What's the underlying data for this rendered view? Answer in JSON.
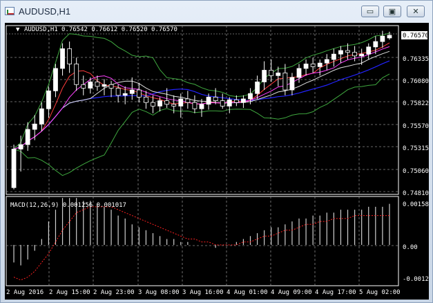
{
  "window": {
    "title": "AUDUSD,H1",
    "buttons": {
      "minimize": "▭",
      "maximize": "▣",
      "close": "✕"
    }
  },
  "colors": {
    "background": "#000000",
    "grid": "#8a8a8a",
    "bull_candle": "#ffffff",
    "bear_candle": "#000000",
    "ma_blue": "#2323ff",
    "ma_white": "#e0e0e0",
    "ma_red": "#ff3c3c",
    "ma_magenta": "#ff40ff",
    "bollinger": "#3fa83f",
    "macd_histogram": "#d0d0d0",
    "macd_signal": "#ff2020",
    "price_marker": "#ffffff"
  },
  "price_panel": {
    "header": "AUDUSD,H1",
    "ohlc": "0.76542 0.76612 0.76520 0.76570",
    "current_price": "0.76570",
    "price_labels": [
      "0.76335",
      "0.76080",
      "0.75822",
      "0.75570",
      "0.75315",
      "0.75060",
      "0.74810"
    ]
  },
  "macd_panel": {
    "label": "MACD(12,26,9) 0.001256 0.001017",
    "labels": [
      "0.001581",
      "0.00",
      "-0.001204"
    ]
  },
  "time_axis": [
    "2 Aug 2016",
    "2 Aug 15:00",
    "2 Aug 23:00",
    "3 Aug 08:00",
    "3 Aug 16:00",
    "4 Aug 01:00",
    "4 Aug 09:00",
    "4 Aug 17:00",
    "5 Aug 02:00"
  ],
  "chart_data": {
    "type": "candlestick",
    "symbol": "AUDUSD",
    "timeframe": "H1",
    "ohlc": [
      [
        0.7487,
        0.7535,
        0.7485,
        0.753
      ],
      [
        0.753,
        0.7545,
        0.7505,
        0.7535
      ],
      [
        0.7535,
        0.756,
        0.7528,
        0.7552
      ],
      [
        0.7552,
        0.7568,
        0.754,
        0.7558
      ],
      [
        0.7558,
        0.7582,
        0.755,
        0.7575
      ],
      [
        0.7575,
        0.76,
        0.7565,
        0.7595
      ],
      [
        0.7595,
        0.7625,
        0.7588,
        0.762
      ],
      [
        0.762,
        0.7648,
        0.7612,
        0.7642
      ],
      [
        0.7642,
        0.765,
        0.7615,
        0.7625
      ],
      [
        0.7625,
        0.7632,
        0.7595,
        0.7602
      ],
      [
        0.7602,
        0.7612,
        0.759,
        0.7598
      ],
      [
        0.7598,
        0.761,
        0.7592,
        0.7605
      ],
      [
        0.7605,
        0.7612,
        0.7595,
        0.76
      ],
      [
        0.76,
        0.7608,
        0.759,
        0.7602
      ],
      [
        0.7602,
        0.7606,
        0.7588,
        0.7598
      ],
      [
        0.7598,
        0.7602,
        0.7582,
        0.759
      ],
      [
        0.759,
        0.76,
        0.758,
        0.7592
      ],
      [
        0.7592,
        0.761,
        0.7585,
        0.7596
      ],
      [
        0.7596,
        0.7604,
        0.7582,
        0.7588
      ],
      [
        0.7588,
        0.7595,
        0.7575,
        0.7582
      ],
      [
        0.7582,
        0.759,
        0.757,
        0.7578
      ],
      [
        0.7578,
        0.7588,
        0.7572,
        0.7584
      ],
      [
        0.7584,
        0.7598,
        0.7576,
        0.758
      ],
      [
        0.758,
        0.759,
        0.757,
        0.7578
      ],
      [
        0.7578,
        0.7592,
        0.7565,
        0.7586
      ],
      [
        0.7586,
        0.7595,
        0.7575,
        0.7582
      ],
      [
        0.7582,
        0.759,
        0.757,
        0.7575
      ],
      [
        0.7575,
        0.7586,
        0.7566,
        0.758
      ],
      [
        0.758,
        0.7592,
        0.7574,
        0.7588
      ],
      [
        0.7588,
        0.7598,
        0.758,
        0.7584
      ],
      [
        0.7584,
        0.7592,
        0.7575,
        0.7578
      ],
      [
        0.7578,
        0.7588,
        0.757,
        0.7585
      ],
      [
        0.7585,
        0.759,
        0.7578,
        0.7582
      ],
      [
        0.7582,
        0.759,
        0.7576,
        0.7586
      ],
      [
        0.7586,
        0.7598,
        0.758,
        0.7592
      ],
      [
        0.7592,
        0.7612,
        0.7586,
        0.7605
      ],
      [
        0.7605,
        0.7628,
        0.7596,
        0.7618
      ],
      [
        0.7618,
        0.763,
        0.7605,
        0.7612
      ],
      [
        0.7612,
        0.7622,
        0.76,
        0.7615
      ],
      [
        0.7615,
        0.7625,
        0.759,
        0.7596
      ],
      [
        0.7596,
        0.7615,
        0.759,
        0.761
      ],
      [
        0.761,
        0.7625,
        0.7604,
        0.762
      ],
      [
        0.762,
        0.763,
        0.7612,
        0.7625
      ],
      [
        0.7625,
        0.7632,
        0.7615,
        0.7622
      ],
      [
        0.7622,
        0.763,
        0.7612,
        0.7626
      ],
      [
        0.7626,
        0.7636,
        0.7618,
        0.763
      ],
      [
        0.763,
        0.7642,
        0.7622,
        0.7636
      ],
      [
        0.7636,
        0.7645,
        0.7626,
        0.764
      ],
      [
        0.764,
        0.7648,
        0.763,
        0.7638
      ],
      [
        0.7638,
        0.7645,
        0.7628,
        0.7634
      ],
      [
        0.7634,
        0.7642,
        0.7624,
        0.7636
      ],
      [
        0.7636,
        0.7648,
        0.763,
        0.7644
      ],
      [
        0.7644,
        0.7656,
        0.7636,
        0.765
      ],
      [
        0.765,
        0.7662,
        0.7643,
        0.7656
      ],
      [
        0.7654,
        0.7661,
        0.7652,
        0.7657
      ]
    ],
    "y_range": [
      0.7481,
      0.7657
    ],
    "macd_histogram": [
      -0.0006,
      -0.0007,
      -0.0005,
      -0.0002,
      0.0002,
      0.0008,
      0.0012,
      0.0016,
      0.0016,
      0.0016,
      0.0015,
      0.0015,
      0.0014,
      0.0013,
      0.0012,
      0.001,
      0.0009,
      0.0007,
      0.0006,
      0.0005,
      0.0004,
      0.0003,
      0.0002,
      0.0002,
      0.0001,
      0.0001,
      0.0,
      0.0,
      0.0,
      -0.0001,
      0.0,
      0.0,
      0.0001,
      0.0002,
      0.0003,
      0.0004,
      0.0005,
      0.0006,
      0.0006,
      0.0007,
      0.0008,
      0.0009,
      0.0009,
      0.001,
      0.001,
      0.0011,
      0.0011,
      0.0012,
      0.0012,
      0.0012,
      0.0012,
      0.0013,
      0.0013,
      0.0013,
      0.0014
    ],
    "macd_signal": [
      -0.0011,
      -0.0012,
      -0.0011,
      -0.0009,
      -0.0006,
      -0.0003,
      0.0001,
      0.0005,
      0.0008,
      0.0011,
      0.0012,
      0.0013,
      0.0013,
      0.0013,
      0.0013,
      0.0012,
      0.0011,
      0.001,
      0.0009,
      0.0008,
      0.0007,
      0.0006,
      0.0005,
      0.0004,
      0.0003,
      0.0002,
      0.0002,
      0.0001,
      0.0001,
      0.0,
      0.0,
      0.0,
      0.0,
      0.0001,
      0.0001,
      0.0002,
      0.0003,
      0.0003,
      0.0004,
      0.0005,
      0.0005,
      0.0006,
      0.0007,
      0.0007,
      0.0008,
      0.0008,
      0.0009,
      0.0009,
      0.0009,
      0.001,
      0.001,
      0.001,
      0.001,
      0.001,
      0.001
    ],
    "macd_range": [
      -0.001204,
      0.001581
    ]
  }
}
